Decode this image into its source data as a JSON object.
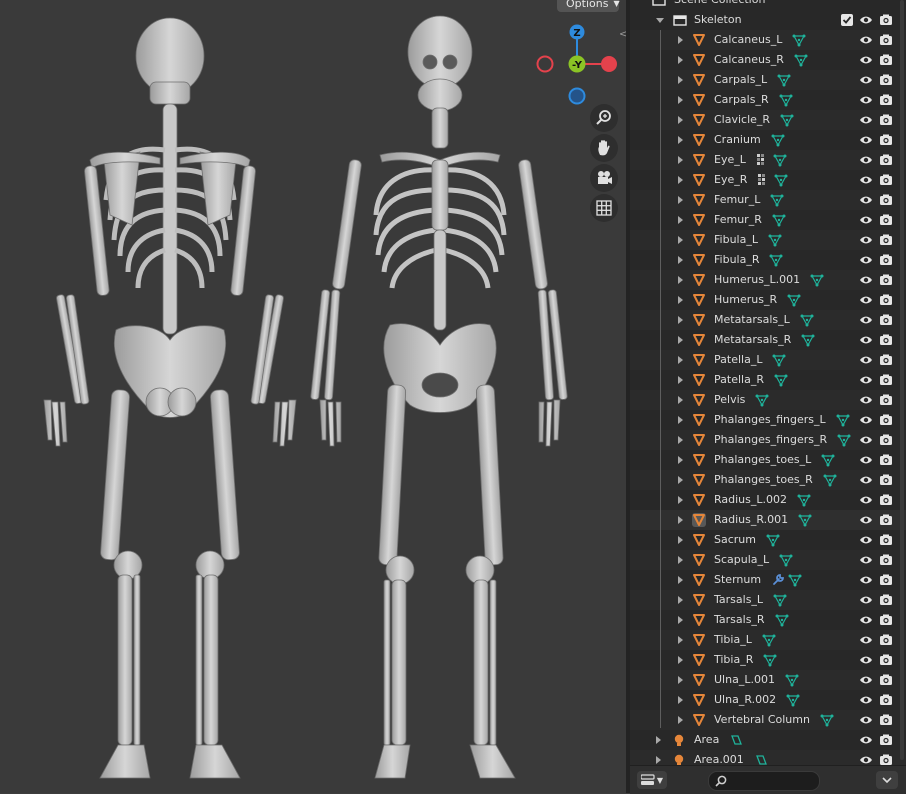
{
  "viewport": {
    "options_label": "Options",
    "gizmo_axes": {
      "z": "Z",
      "y": "-Y",
      "colors": {
        "x": "#e4424c",
        "y": "#8bc425",
        "z": "#2e8bde",
        "x_neg": "#a23a41",
        "z_neg": "#24548a"
      }
    },
    "nav_buttons": [
      "zoom-icon",
      "hand-pan-icon",
      "camera-icon",
      "grid-icon"
    ]
  },
  "outliner": {
    "top_partial_label": "Scene Collection",
    "collection": {
      "label": "Skeleton",
      "checked": true
    },
    "objects": [
      {
        "label": "Calcaneus_L",
        "data_icon": "mesh"
      },
      {
        "label": "Calcaneus_R",
        "data_icon": "mesh"
      },
      {
        "label": "Carpals_L",
        "data_icon": "mesh"
      },
      {
        "label": "Carpals_R",
        "data_icon": "mesh"
      },
      {
        "label": "Clavicle_R",
        "data_icon": "mesh"
      },
      {
        "label": "Cranium",
        "data_icon": "mesh"
      },
      {
        "label": "Eye_L",
        "data_icon": "mesh",
        "extra_icon": "material"
      },
      {
        "label": "Eye_R",
        "data_icon": "mesh",
        "extra_icon": "material"
      },
      {
        "label": "Femur_L",
        "data_icon": "mesh"
      },
      {
        "label": "Femur_R",
        "data_icon": "mesh"
      },
      {
        "label": "Fibula_L",
        "data_icon": "mesh"
      },
      {
        "label": "Fibula_R",
        "data_icon": "mesh"
      },
      {
        "label": "Humerus_L.001",
        "data_icon": "mesh"
      },
      {
        "label": "Humerus_R",
        "data_icon": "mesh"
      },
      {
        "label": "Metatarsals_L",
        "data_icon": "mesh"
      },
      {
        "label": "Metatarsals_R",
        "data_icon": "mesh"
      },
      {
        "label": "Patella_L",
        "data_icon": "mesh"
      },
      {
        "label": "Patella_R",
        "data_icon": "mesh"
      },
      {
        "label": "Pelvis",
        "data_icon": "mesh"
      },
      {
        "label": "Phalanges_fingers_L",
        "data_icon": "mesh"
      },
      {
        "label": "Phalanges_fingers_R",
        "data_icon": "mesh"
      },
      {
        "label": "Phalanges_toes_L",
        "data_icon": "mesh"
      },
      {
        "label": "Phalanges_toes_R",
        "data_icon": "mesh"
      },
      {
        "label": "Radius_L.002",
        "data_icon": "mesh"
      },
      {
        "label": "Radius_R.001",
        "data_icon": "mesh",
        "selected": true
      },
      {
        "label": "Sacrum",
        "data_icon": "mesh"
      },
      {
        "label": "Scapula_L",
        "data_icon": "mesh"
      },
      {
        "label": "Sternum",
        "data_icon": "mesh",
        "extra_icon": "modifier"
      },
      {
        "label": "Tarsals_L",
        "data_icon": "mesh"
      },
      {
        "label": "Tarsals_R",
        "data_icon": "mesh"
      },
      {
        "label": "Tibia_L",
        "data_icon": "mesh"
      },
      {
        "label": "Tibia_R",
        "data_icon": "mesh"
      },
      {
        "label": "Ulna_L.001",
        "data_icon": "mesh"
      },
      {
        "label": "Ulna_R.002",
        "data_icon": "mesh"
      },
      {
        "label": "Vertebral Column",
        "data_icon": "mesh"
      }
    ],
    "lights": [
      {
        "label": "Area",
        "data_icon": "area-light"
      },
      {
        "label": "Area.001",
        "data_icon": "area-light"
      }
    ],
    "colors": {
      "object": "#e5863a",
      "mesh_data": "#1fb39b",
      "modifier": "#5a8fd6",
      "light": "#e5863a"
    }
  },
  "footer": {
    "search_placeholder": "",
    "display_mode_icon": "outliner-display-icon",
    "filter_icon": "filter-chevron-icon"
  }
}
